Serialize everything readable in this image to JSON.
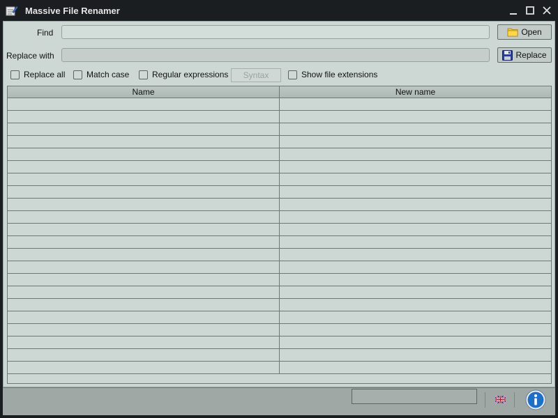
{
  "window": {
    "title": "Massive File Renamer"
  },
  "find": {
    "label": "Find",
    "value": "",
    "open_button": "Open"
  },
  "replace": {
    "label": "Replace with",
    "value": "",
    "replace_button": "Replace"
  },
  "options": {
    "replace_all": {
      "label": "Replace all",
      "checked": false
    },
    "match_case": {
      "label": "Match case",
      "checked": false
    },
    "regular_expressions": {
      "label": "Regular expressions",
      "checked": false
    },
    "syntax_button": "Syntax",
    "show_file_extensions": {
      "label": "Show file extensions",
      "checked": false
    }
  },
  "table": {
    "columns": [
      "Name",
      "New name"
    ],
    "rows": []
  },
  "colors": {
    "accent_info": "#1f6fc4",
    "client_bg": "#cdd7d3",
    "titlebar_bg": "#1b1e20"
  },
  "icons": {
    "app": "rename-app-icon",
    "open": "folder-icon",
    "replace": "floppy-disk-icon",
    "language": "uk-flag-icon",
    "info": "info-icon"
  }
}
